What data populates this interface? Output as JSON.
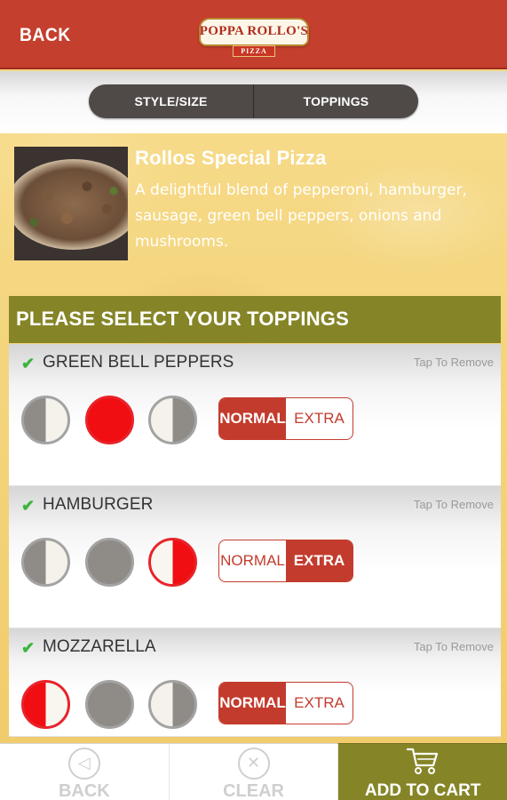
{
  "header": {
    "back_label": "BACK",
    "logo_text": "POPPA ROLLO'S",
    "logo_sub": "PIZZA"
  },
  "tabs": [
    {
      "label": "STYLE/SIZE"
    },
    {
      "label": "TOPPINGS"
    }
  ],
  "product": {
    "title": "Rollos Special Pizza",
    "description": "A delightful blend of pepperoni, hamburger, sausage, green bell peppers, onions and mushrooms."
  },
  "section_title": "PLEASE SELECT YOUR TOPPINGS",
  "toppings": [
    {
      "name": "GREEN BELL PEPPERS",
      "remove_label": "Tap To Remove",
      "coverage": "whole",
      "amount": "NORMAL"
    },
    {
      "name": "HAMBURGER",
      "remove_label": "Tap To Remove",
      "coverage": "right",
      "amount": "EXTRA"
    },
    {
      "name": "MOZZARELLA",
      "remove_label": "Tap To Remove",
      "coverage": "left",
      "amount": "NORMAL"
    }
  ],
  "amount_options": [
    "NORMAL",
    "EXTRA"
  ],
  "footer": {
    "back_label": "BACK",
    "clear_label": "CLEAR",
    "add_to_cart_label": "ADD TO CART"
  },
  "colors": {
    "header_red": "#c53f2e",
    "section_olive": "#858528",
    "selected_red": "#f00e12",
    "check_green": "#3cb43c"
  }
}
